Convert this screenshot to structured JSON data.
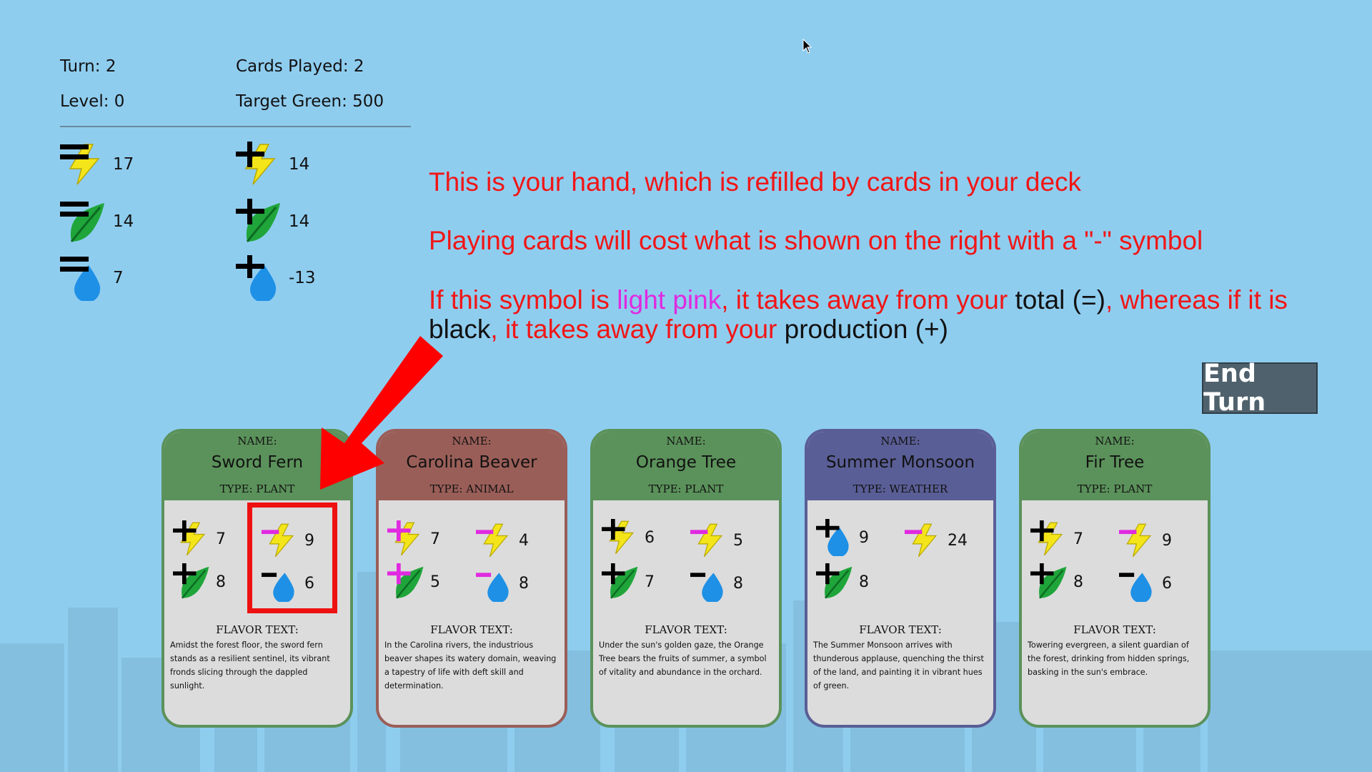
{
  "stats": {
    "turn": "Turn: 2",
    "cards_played": "Cards Played: 2",
    "level": "Level: 0",
    "target_green": "Target Green: 500"
  },
  "resources": {
    "total": {
      "energy": "17",
      "leaf": "14",
      "water": "7"
    },
    "production": {
      "energy": "14",
      "leaf": "14",
      "water": "-13"
    }
  },
  "tutorial": {
    "line1": "This is your hand, which is refilled by cards in your deck",
    "line2": "Playing cards will cost what is shown on the right with a \"-\" symbol",
    "line3_a": "If this symbol is ",
    "line3_b": "light pink",
    "line3_c": ", it takes away from your ",
    "line3_d": "total (=)",
    "line3_e": ", whereas if it is ",
    "line3_f": "black",
    "line3_g": ", it takes away from your ",
    "line3_h": "production (+)"
  },
  "end_turn_label": "End Turn",
  "colors": {
    "background": "#8fcdef",
    "plant": "#5b925b",
    "animal": "#9a5e58",
    "weather": "#5a5e96",
    "tutorial_red": "#f01616",
    "light_pink": "#e02ae0",
    "energy": "#f3e51a",
    "leaf": "#1fa53a",
    "water": "#1e90e6"
  },
  "labels": {
    "name": "NAME:",
    "flavor": "FLAVOR TEXT:"
  },
  "cards": [
    {
      "name": "Sword Fern",
      "type": "TYPE: PLANT",
      "gain1": "7",
      "gain2": "8",
      "cost1": "9",
      "cost2": "6",
      "flavor": "Amidst the forest floor, the sword fern stands as a resilient sentinel, its vibrant fronds slicing through the dappled sunlight."
    },
    {
      "name": "Carolina Beaver",
      "type": "TYPE: ANIMAL",
      "gain1": "7",
      "gain2": "5",
      "cost1": "4",
      "cost2": "8",
      "flavor": "In the Carolina rivers, the industrious beaver shapes its watery domain, weaving a tapestry of life with deft skill and determination."
    },
    {
      "name": "Orange Tree",
      "type": "TYPE: PLANT",
      "gain1": "6",
      "gain2": "7",
      "cost1": "5",
      "cost2": "8",
      "flavor": "Under the sun's golden gaze, the Orange Tree bears the fruits of summer, a symbol of vitality and abundance in the orchard."
    },
    {
      "name": "Summer Monsoon",
      "type": "TYPE: WEATHER",
      "gain1": "9",
      "gain2": "8",
      "cost1": "24",
      "flavor": "The Summer Monsoon arrives with thunderous applause, quenching the thirst of the land, and painting it in vibrant hues of green."
    },
    {
      "name": "Fir Tree",
      "type": "TYPE: PLANT",
      "gain1": "7",
      "gain2": "8",
      "cost1": "9",
      "cost2": "6",
      "flavor": "Towering evergreen, a silent guardian of the forest, drinking from hidden springs, basking in the sun's embrace."
    }
  ]
}
